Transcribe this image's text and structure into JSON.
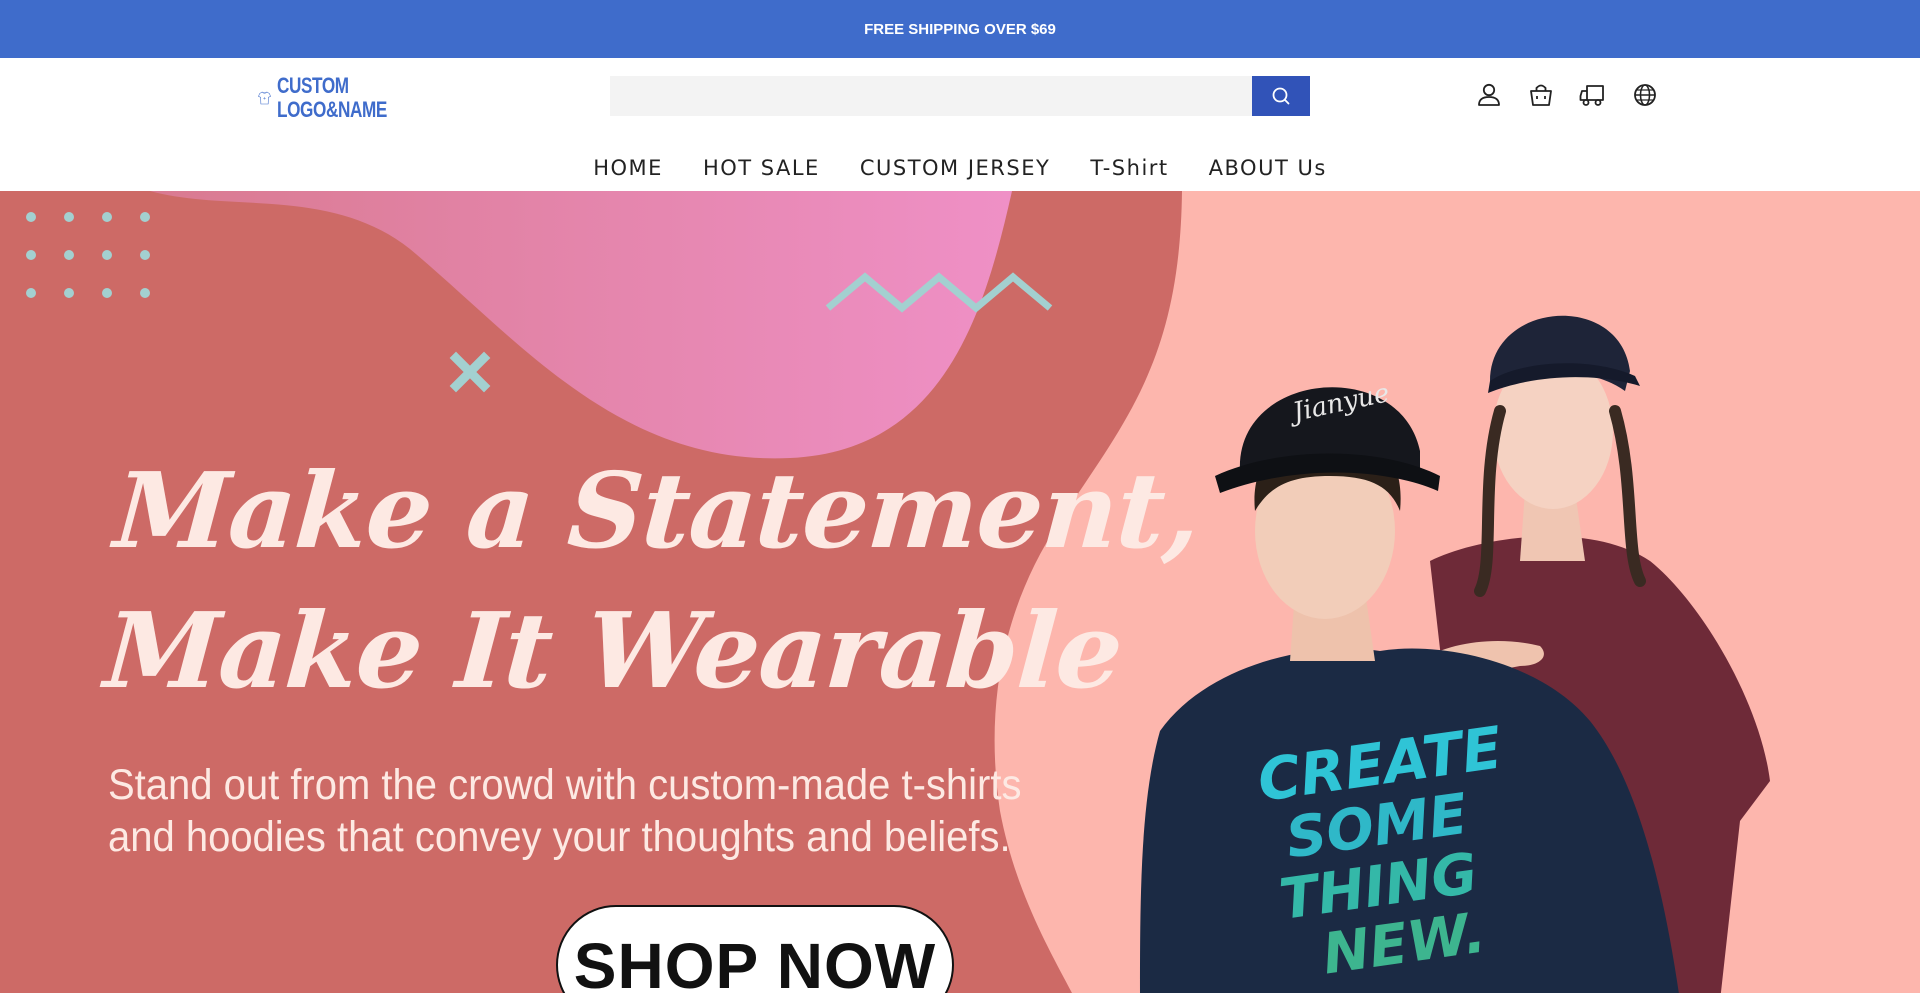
{
  "announcement": {
    "text": "FREE SHIPPING OVER $69"
  },
  "header": {
    "logo": {
      "line1": "CUSTOM",
      "line2": "LOGO&NAME"
    },
    "search": {
      "placeholder": "",
      "value": ""
    },
    "icons": [
      "user-icon",
      "cart-icon",
      "truck-icon",
      "globe-icon"
    ]
  },
  "nav": {
    "items": [
      {
        "label": "HOME"
      },
      {
        "label": "HOT SALE"
      },
      {
        "label": "CUSTOM JERSEY"
      },
      {
        "label": "T-Shirt"
      },
      {
        "label": "ABOUT Us"
      }
    ]
  },
  "hero": {
    "headline_line1": "Make a Statement,",
    "headline_line2": "Make It Wearable",
    "subtext_line1": "Stand out from the crowd with custom-made t-shirts",
    "subtext_line2": "and hoodies that convey your thoughts and beliefs.",
    "cta_label": "SHOP NOW",
    "tshirt_print": "CREATE SOME THING NEW.",
    "cap_logo": "Jianyue"
  },
  "colors": {
    "announcement_bg": "#3f6ccb",
    "search_button": "#3153b8",
    "hero_coral": "#cd6a66",
    "hero_pink": "#fdb6ad",
    "hero_blob": "#ea8cba",
    "accent_teal": "#a3d0d0",
    "headline_text": "#fde9e3"
  }
}
